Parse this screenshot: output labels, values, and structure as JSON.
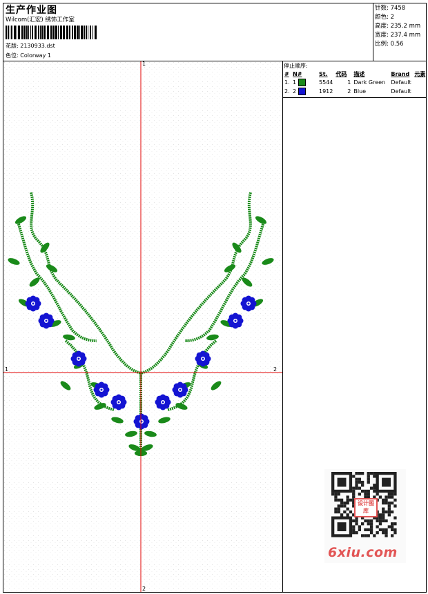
{
  "header": {
    "title": "生产作业图",
    "company": "Wilcom(汇宏) 绣饰工作室",
    "design_label": "花版:",
    "design_value": "2130933.dst",
    "colorway_label": "色位:",
    "colorway_value": "Colorway 1"
  },
  "stats": {
    "stitches_label": "针数:",
    "stitches_value": "7458",
    "colors_label": "颜色:",
    "colors_value": "2",
    "height_label": "高度:",
    "height_value": "235.2 mm",
    "width_label": "宽度:",
    "width_value": "237.4 mm",
    "scale_label": "比例:",
    "scale_value": "0.56"
  },
  "stop_sequence": {
    "title": "停止顺序:",
    "headers": [
      "#",
      "N#",
      "St.",
      "代码",
      "描述",
      "Brand",
      "元素"
    ],
    "rows": [
      {
        "index": "1.",
        "needle": "1",
        "color": "#1a8a1a",
        "stitches": "5544",
        "code": "1",
        "description": "Dark Green",
        "brand": "Default"
      },
      {
        "index": "2.",
        "needle": "2",
        "color": "#1414d2",
        "stitches": "1912",
        "code": "2",
        "description": "Blue",
        "brand": "Default"
      }
    ]
  },
  "axes": {
    "top": "1",
    "bottom": "2",
    "left": "1",
    "right": "2"
  },
  "watermark": {
    "site": "6xiu.com",
    "seal": "设计图库"
  }
}
